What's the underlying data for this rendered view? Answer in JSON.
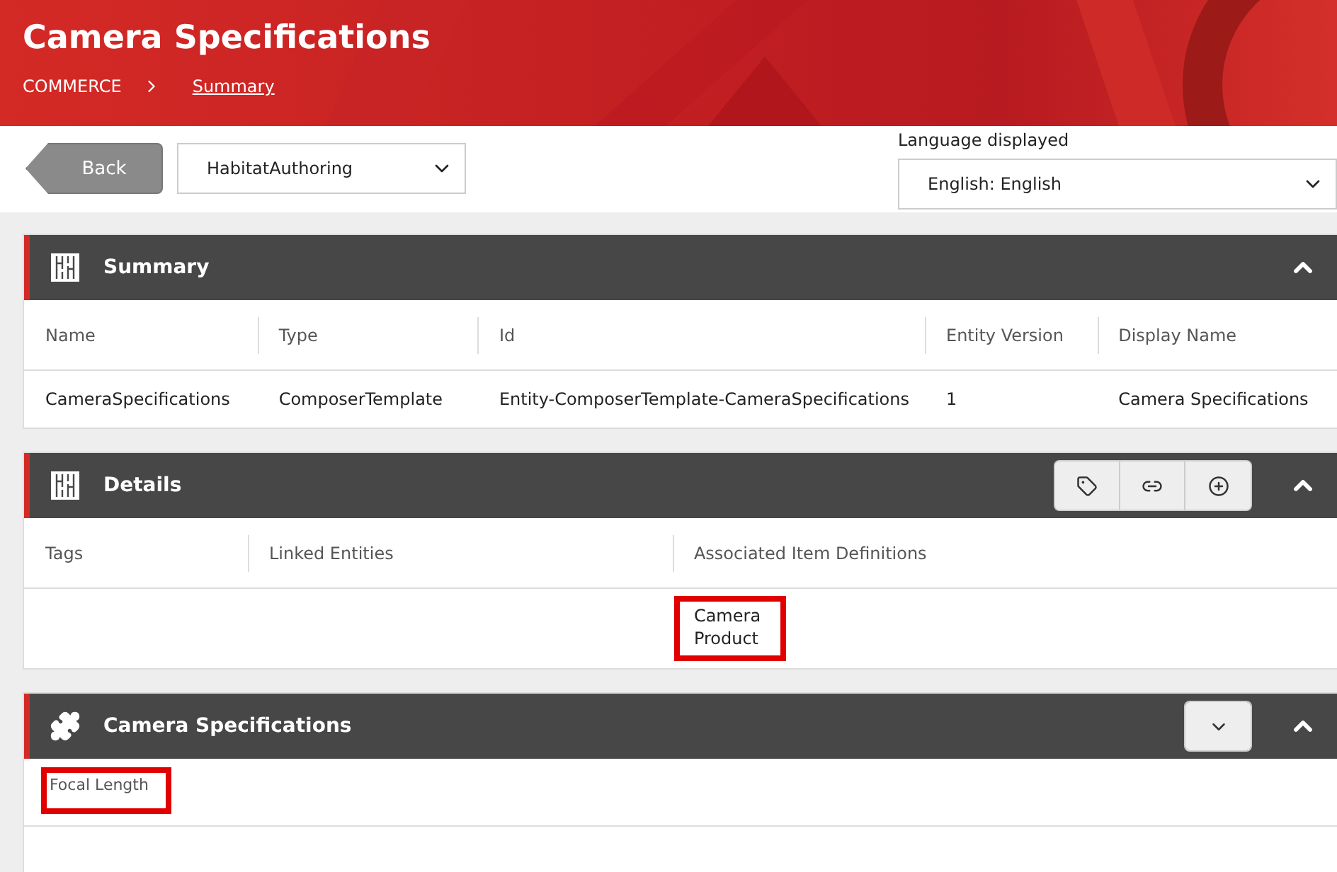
{
  "header": {
    "title": "Camera Specifications",
    "breadcrumb": [
      {
        "label": "COMMERCE",
        "current": false
      },
      {
        "label": "Summary",
        "current": true
      }
    ]
  },
  "toolbar": {
    "back": "Back",
    "catalog": "HabitatAuthoring",
    "language_label": "Language displayed",
    "language": "English: English"
  },
  "panels": [
    {
      "kind": "summary",
      "title": "Summary",
      "expanded": true,
      "columns": [
        "Name",
        "Type",
        "Id",
        "Entity Version",
        "Display Name"
      ],
      "rows": [
        [
          {
            "text": "CameraSpecifications",
            "highlighted": false
          },
          {
            "text": "ComposerTemplate",
            "highlighted": false
          },
          {
            "text": "Entity-ComposerTemplate-CameraSpecifications",
            "highlighted": false
          },
          {
            "text": "1",
            "highlighted": false
          },
          {
            "text": "Camera Specifications",
            "highlighted": false
          }
        ]
      ]
    },
    {
      "kind": "details",
      "title": "Details",
      "expanded": true,
      "columns": [
        "Tags",
        "Linked Entities",
        "Associated Item Definitions"
      ],
      "rows": [
        [
          null,
          null,
          {
            "text": "Camera\nProduct",
            "highlighted": true
          }
        ]
      ]
    },
    {
      "kind": "attributes",
      "title": "Camera Specifications",
      "expanded": true,
      "fields": [
        {
          "label": "Focal Length",
          "highlighted": true
        }
      ]
    }
  ]
}
